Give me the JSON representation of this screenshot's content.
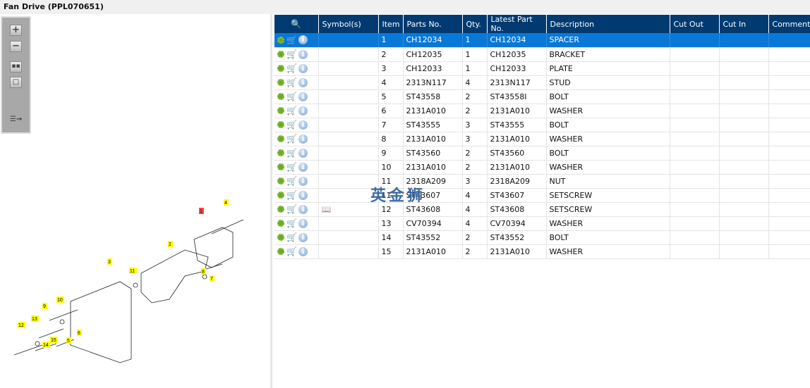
{
  "title": "Fan Drive (PPL070651)",
  "toolbar": {
    "zoom_in": "+",
    "zoom_out": "−",
    "fit": "fit-all",
    "actual": "actual-size",
    "export": "show-list"
  },
  "drawing": {
    "callouts": [
      "1",
      "4",
      "2",
      "3",
      "11",
      "8",
      "7",
      "10",
      "9",
      "13",
      "12",
      "15",
      "14",
      "5",
      "6"
    ]
  },
  "watermark": "英金狮",
  "table": {
    "headers": [
      "",
      "Symbol(s)",
      "Item",
      "Parts No.",
      "Qty.",
      "Latest Part No.",
      "Description",
      "Cut Out",
      "Cut In",
      "Comment"
    ],
    "rows": [
      {
        "item": "1",
        "part": "CH12034",
        "qty": "1",
        "latest": "CH12034",
        "desc": "SPACER"
      },
      {
        "item": "2",
        "part": "CH12035",
        "qty": "1",
        "latest": "CH12035",
        "desc": "BRACKET"
      },
      {
        "item": "3",
        "part": "CH12033",
        "qty": "1",
        "latest": "CH12033",
        "desc": "PLATE"
      },
      {
        "item": "4",
        "part": "2313N117",
        "qty": "4",
        "latest": "2313N117",
        "desc": "STUD"
      },
      {
        "item": "5",
        "part": "ST43558",
        "qty": "2",
        "latest": "ST43558I",
        "desc": "BOLT"
      },
      {
        "item": "6",
        "part": "2131A010",
        "qty": "2",
        "latest": "2131A010",
        "desc": "WASHER"
      },
      {
        "item": "7",
        "part": "ST43555",
        "qty": "3",
        "latest": "ST43555",
        "desc": "BOLT"
      },
      {
        "item": "8",
        "part": "2131A010",
        "qty": "3",
        "latest": "2131A010",
        "desc": "WASHER"
      },
      {
        "item": "9",
        "part": "ST43560",
        "qty": "2",
        "latest": "ST43560",
        "desc": "BOLT"
      },
      {
        "item": "10",
        "part": "2131A010",
        "qty": "2",
        "latest": "2131A010",
        "desc": "WASHER"
      },
      {
        "item": "11",
        "part": "2318A209",
        "qty": "3",
        "latest": "2318A209",
        "desc": "NUT"
      },
      {
        "item": "11",
        "part": "ST43607",
        "qty": "4",
        "latest": "ST43607",
        "desc": "SETSCREW"
      },
      {
        "item": "12",
        "part": "ST43608",
        "qty": "4",
        "latest": "ST43608",
        "desc": "SETSCREW",
        "symbol": "book"
      },
      {
        "item": "13",
        "part": "CV70394",
        "qty": "4",
        "latest": "CV70394",
        "desc": "WASHER"
      },
      {
        "item": "14",
        "part": "ST43552",
        "qty": "2",
        "latest": "ST43552",
        "desc": "BOLT"
      },
      {
        "item": "15",
        "part": "2131A010",
        "qty": "2",
        "latest": "2131A010",
        "desc": "WASHER"
      }
    ]
  },
  "colors": {
    "header": "#003a70",
    "selected": "#0a78d7",
    "callout": "#ffff00",
    "callout_active": "#ff4444"
  }
}
